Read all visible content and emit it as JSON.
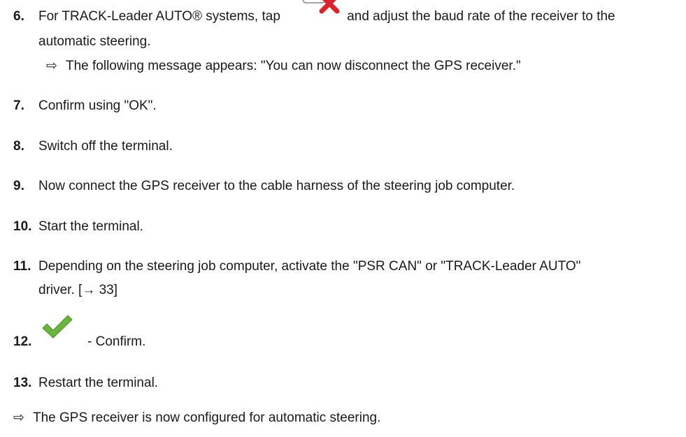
{
  "steps": [
    {
      "num": "6.",
      "text_a": "For TRACK-Leader AUTO® systems, tap",
      "text_b": "and adjust the baud rate of the receiver to the",
      "text_c": "automatic steering.",
      "result": "The following message appears: \"You can now disconnect the GPS receiver.\""
    },
    {
      "num": "7.",
      "text": "Confirm using \"OK\"."
    },
    {
      "num": "8.",
      "text": "Switch off the terminal."
    },
    {
      "num": "9.",
      "text": "Now connect the GPS receiver to the cable harness of the steering job computer."
    },
    {
      "num": "10.",
      "text": "Start the terminal."
    },
    {
      "num": "11.",
      "text_a": "Depending on the steering job computer, activate the \"PSR CAN\" or \"TRACK-Leader AUTO\"",
      "text_b": "driver. [",
      "link_arrow": "→",
      "link_page": "33",
      "text_c": "]"
    },
    {
      "num": "12.",
      "text": "- Confirm."
    },
    {
      "num": "13.",
      "text": "Restart the terminal."
    }
  ],
  "final_result": "The GPS receiver is now configured for automatic steering.",
  "result_arrow": "⇨",
  "icons": {
    "disconnect": "serial-port-disconnect-icon",
    "confirm": "green-checkmark-icon"
  },
  "colors": {
    "text": "#1a1a1a",
    "check_green": "#6db33f",
    "cross_red": "#d9262e"
  }
}
